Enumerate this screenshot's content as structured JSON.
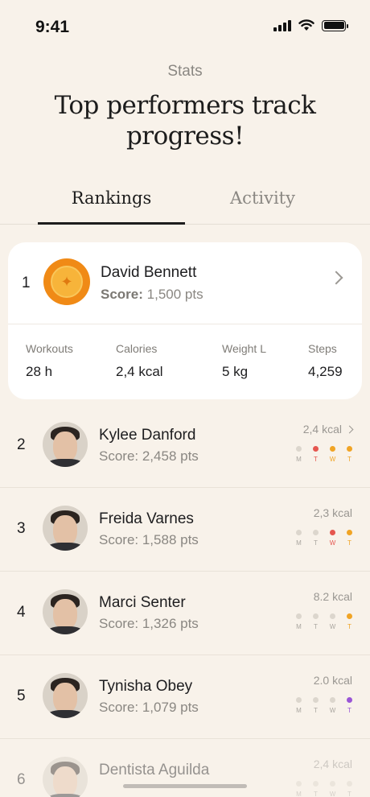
{
  "status": {
    "time": "9:41"
  },
  "header": {
    "kicker": "Stats",
    "title": "Top performers track progress!"
  },
  "tabs": [
    {
      "label": "Rankings"
    },
    {
      "label": "Activity"
    }
  ],
  "top_card": {
    "rank": "1",
    "name": "David Bennett",
    "score_label": "Score:",
    "score_value": "1,500 pts",
    "stats": [
      {
        "label": "Workouts",
        "value": "28 h"
      },
      {
        "label": "Calories",
        "value": "2,4 kcal"
      },
      {
        "label": "Weight L",
        "value": "5 kg"
      },
      {
        "label": "Steps",
        "value": "4,259"
      }
    ]
  },
  "colors": {
    "red": "#e5564f",
    "orange": "#f0a425",
    "purple": "#9a55d6",
    "muted": "#dcd6cd",
    "background": "#f8f2ea",
    "medal": "#f08a16"
  },
  "rows": [
    {
      "rank": "2",
      "name": "Kylee Danford",
      "score": "Score: 2,458 pts",
      "kcal": "2,4 kcal",
      "days": [
        "M",
        "T",
        "W",
        "T"
      ],
      "active": [
        null,
        "#e5564f",
        "#f0a425",
        "#f0a425"
      ]
    },
    {
      "rank": "3",
      "name": "Freida Varnes",
      "score": "Score: 1,588 pts",
      "kcal": "2,3 kcal",
      "days": [
        "M",
        "T",
        "W",
        "T"
      ],
      "active": [
        null,
        null,
        "#e5564f",
        "#f0a425"
      ]
    },
    {
      "rank": "4",
      "name": "Marci Senter",
      "score": "Score: 1,326 pts",
      "kcal": "8.2 kcal",
      "days": [
        "M",
        "T",
        "W",
        "T"
      ],
      "active": [
        null,
        null,
        null,
        "#f0a425"
      ]
    },
    {
      "rank": "5",
      "name": "Tynisha Obey",
      "score": "Score: 1,079 pts",
      "kcal": "2.0 kcal",
      "days": [
        "M",
        "T",
        "W",
        "T"
      ],
      "active": [
        null,
        null,
        null,
        "#9a55d6"
      ]
    },
    {
      "rank": "6",
      "name": "Dentista Aguilda",
      "score": "",
      "kcal": "2,4 kcal",
      "days": [
        "M",
        "T",
        "W",
        "T"
      ],
      "active": [
        null,
        null,
        null,
        null
      ]
    }
  ]
}
